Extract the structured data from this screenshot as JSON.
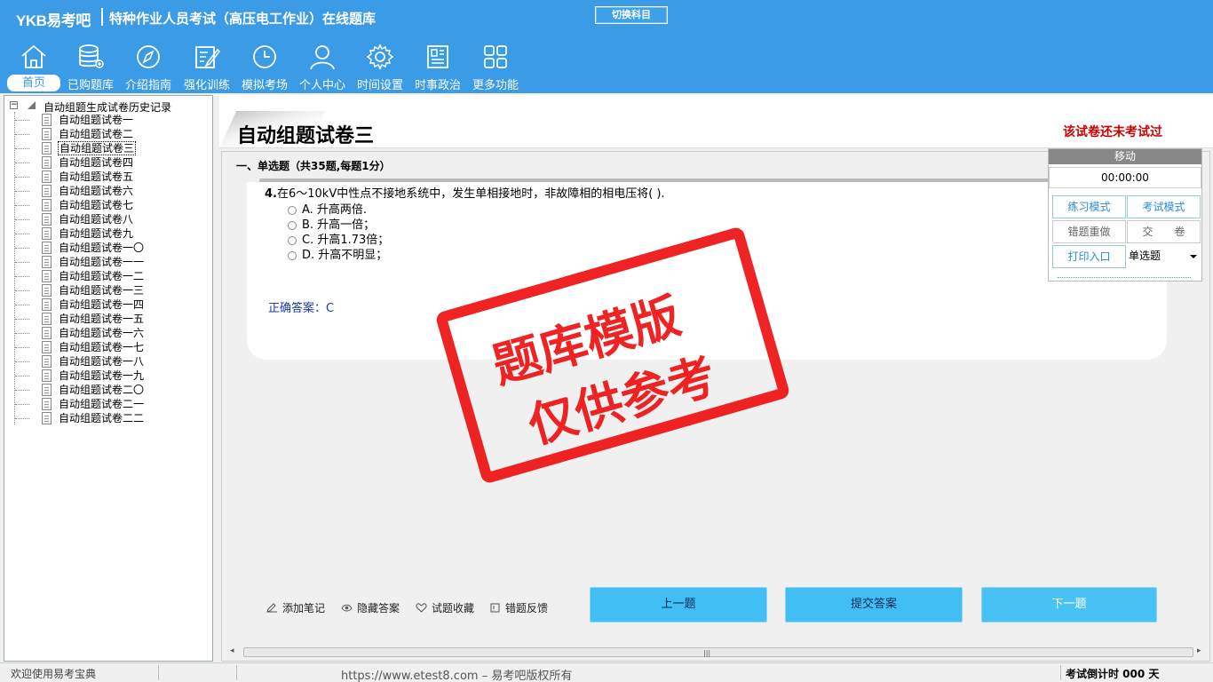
{
  "header": {
    "logo": "YKB易考吧",
    "title": "特种作业人员考试（高压电工作业）在线题库",
    "switch_label": "切换科目"
  },
  "nav": {
    "items": [
      {
        "label": "首页",
        "icon": "home-icon"
      },
      {
        "label": "已购题库",
        "icon": "database-icon"
      },
      {
        "label": "介绍指南",
        "icon": "compass-icon"
      },
      {
        "label": "强化训练",
        "icon": "edit-icon"
      },
      {
        "label": "模拟考场",
        "icon": "clock-icon"
      },
      {
        "label": "个人中心",
        "icon": "user-icon"
      },
      {
        "label": "时间设置",
        "icon": "gear-icon"
      },
      {
        "label": "时事政治",
        "icon": "news-icon"
      },
      {
        "label": "更多功能",
        "icon": "grid-icon"
      }
    ]
  },
  "tree": {
    "root": "自动组题生成试卷历史记录",
    "items": [
      "自动组题试卷一",
      "自动组题试卷二",
      "自动组题试卷三",
      "自动组题试卷四",
      "自动组题试卷五",
      "自动组题试卷六",
      "自动组题试卷七",
      "自动组题试卷八",
      "自动组题试卷九",
      "自动组题试卷一〇",
      "自动组题试卷一一",
      "自动组题试卷一二",
      "自动组题试卷一三",
      "自动组题试卷一四",
      "自动组题试卷一五",
      "自动组题试卷一六",
      "自动组题试卷一七",
      "自动组题试卷一八",
      "自动组题试卷一九",
      "自动组题试卷二〇",
      "自动组题试卷二一",
      "自动组题试卷二二"
    ],
    "selected_index": 2
  },
  "paper": {
    "title": "自动组题试卷三",
    "status": "该试卷还未考试过"
  },
  "section": {
    "title": "一、单选题（共35题,每题1分）"
  },
  "question": {
    "number": "4.",
    "text": "在6～10kV中性点不接地系统中，发生单相接地时，非故障相的相电压将(  ).",
    "options": [
      "A. 升高两倍.",
      "B. 升高一倍；",
      "C. 升高1.73倍；",
      "D. 升高不明显；"
    ],
    "answer_label": "正确答案：C"
  },
  "tools": {
    "note": "添加笔记",
    "hide_answer": "隐藏答案",
    "favorite": "试题收藏",
    "feedback": "错题反馈"
  },
  "buttons": {
    "prev": "上一题",
    "submit": "提交答案",
    "next": "下一题"
  },
  "control": {
    "move": "移动",
    "timer": "00:00:00",
    "practice": "练习模式",
    "exam": "考试模式",
    "redo": "错题重做",
    "hand_in": "交　　卷",
    "print": "打印入口",
    "type_select": "单选题"
  },
  "stamp": {
    "line1": "题库模版",
    "line2": "仅供参考"
  },
  "status": {
    "welcome": "欢迎使用易考宝典",
    "copyright": "https://www.etest8.com – 易考吧版权所有",
    "countdown": "考试倒计时 000 天"
  },
  "colors": {
    "header": "#3b9be6",
    "button": "#41bff5",
    "stamp": "#e11111",
    "status_red": "#cc0000"
  }
}
